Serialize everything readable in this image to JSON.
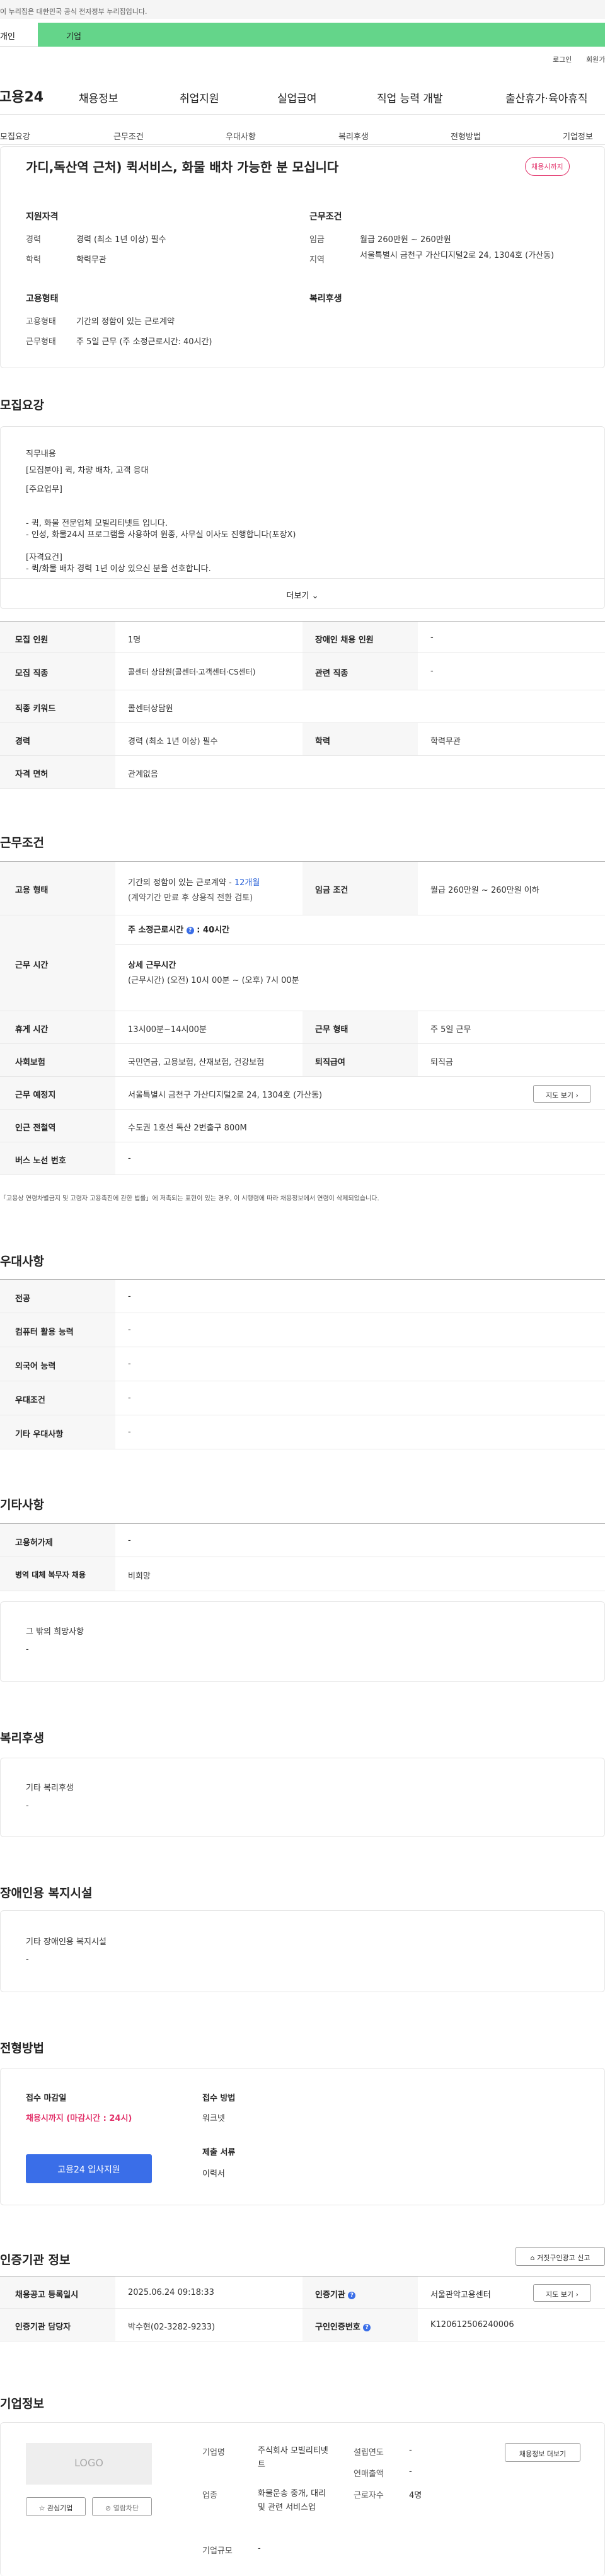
{
  "notice": {
    "text": "이 누리집은 대한민국 공식 전자정부 누리집입니다."
  },
  "top_tabs": [
    "개인",
    "기업"
  ],
  "utility": {
    "login": "로그인",
    "join": "회원가입"
  },
  "gnb": {
    "logo": "고용24",
    "menu": [
      "채용정보",
      "취업지원",
      "실업급여",
      "직업 능력 개발",
      "출산휴가·육아휴직"
    ]
  },
  "anchor_tabs": [
    "모집요강",
    "근무조건",
    "우대사항",
    "복리후생",
    "전형방법",
    "기업정보"
  ],
  "summary": {
    "title": "가디,독산역 근처) 퀵서비스, 화물 배차 가능한 분 모십니다",
    "status_badge": "채용시까지",
    "qualification": {
      "heading": "지원자격",
      "career_label": "경력",
      "career_value": "경력 (최소 1년 이상) 필수",
      "edu_label": "학력",
      "edu_value": "학력무관"
    },
    "conditions": {
      "heading": "근무조건",
      "wage_label": "임금",
      "wage_value": "월급 260만원 ~ 260만원",
      "region_label": "지역",
      "region_value": "서울특별시 금천구 가산디지털2로 24, 1304호 (가산동)"
    },
    "employment": {
      "heading": "고용형태",
      "type_label": "고용형태",
      "type_value": "기간의 정함이 있는 근로계약",
      "work_label": "근무형태",
      "work_value": "주 5일 근무 (주 소정근로시간: 40시간)"
    },
    "welfare": {
      "heading": "복리후생"
    }
  },
  "recruit": {
    "heading": "모집요강",
    "job_desc_label": "직무내용",
    "job_desc_lines": [
      "[모집분야] 퀵, 차량 배차, 고객 응대",
      "[주요업무]",
      "- 퀵, 화물 전문업체 모빌리티넷트 입니다.",
      "- 인성, 화물24시 프로그램을 사용하여 원종, 사무실 이사도 진행합니다(포장X)",
      "[자격요건]",
      "- 퀵/화물 배차 경력 1년 이상 있으신 분을 선호합니다."
    ],
    "more": "더보기",
    "table": {
      "count_label": "모집 인원",
      "count_value": "1명",
      "disabled_label": "장애인 채용 인원",
      "disabled_value": "-",
      "job_label": "모집 직종",
      "job_value": "콜센터 상담원(콜센터·고객센터·CS센터)",
      "related_label": "관련 직종",
      "related_value": "-",
      "keyword_label": "직종 키워드",
      "keyword_value": "콜센터상담원",
      "career_label": "경력",
      "career_value": "경력 (최소 1년 이상) 필수",
      "edu_label": "학력",
      "edu_value": "학력무관",
      "license_label": "자격 면허",
      "license_value": "관계없음"
    }
  },
  "work": {
    "heading": "근무조건",
    "emp_type_label": "고용 형태",
    "emp_type_value": "기간의 정함이 있는 근로계약 - ",
    "emp_period": "12개월",
    "emp_note": "(계약기간 만료 후 상용직 전환 검토)",
    "wage_label": "임금 조건",
    "wage_value": "월급 260만원 ~ 260만원 이하",
    "hours_label": "근무 시간",
    "weekly_label": "주 소정근로시간",
    "weekly_value": "40시간",
    "detail_label": "상세 근무시간",
    "detail_value": "(근무시간) (오전) 10시 00분 ~ (오후) 7시 00분",
    "break_label": "휴게 시간",
    "break_value": "13시00분~14시00분",
    "shift_label": "근무 형태",
    "shift_value": "주 5일 근무",
    "insurance_label": "사회보험",
    "insurance_value": "국민연금, 고용보험, 산재보험, 건강보험",
    "retire_label": "퇴직급여",
    "retire_value": "퇴직금",
    "place_label": "근무 예정지",
    "place_value": "서울특별시 금천구 가산디지털2로 24, 1304호 (가산동)",
    "map_button": "지도 보기",
    "station_label": "인근 전철역",
    "station_value": "수도권 1호선 독산 2번출구 800M",
    "bus_label": "버스 노선 번호",
    "bus_value": "-",
    "footnote": "「고용상 연령차별금지 및 고령자 고용촉진에 관한 법률」에 저촉되는 표현이 있는 경우, 이 시행령에 따라 채용정보에서 연령이 삭제되었습니다."
  },
  "preference": {
    "heading": "우대사항",
    "rows": [
      {
        "label": "전공",
        "value": "-"
      },
      {
        "label": "컴퓨터 활용 능력",
        "value": "-"
      },
      {
        "label": "외국어 능력",
        "value": "-"
      },
      {
        "label": "우대조건",
        "value": "-"
      },
      {
        "label": "기타 우대사항",
        "value": "-"
      }
    ]
  },
  "etc": {
    "heading": "기타사항",
    "rows": [
      {
        "label": "고용허가제",
        "value": "-"
      },
      {
        "label": "병역 대체 복무자 채용",
        "value": "비희망"
      }
    ],
    "other_label": "그 밖의 희망사항",
    "other_value": "-"
  },
  "benefits": {
    "heading": "복리후생",
    "label": "기타 복리후생",
    "value": "-"
  },
  "disability": {
    "heading": "장애인용 복지시설",
    "label": "기타 장애인용 복지시설",
    "value": "-"
  },
  "process": {
    "heading": "전형방법",
    "deadline_label": "접수 마감일",
    "deadline_value": "채용시까지 (마감시간 : 24시)",
    "apply_button": "고용24 입사지원",
    "method_label": "접수 방법",
    "method_value": "워크넷",
    "docs_label": "제출 서류",
    "docs_value": "이력서"
  },
  "agency": {
    "heading": "인증기관 정보",
    "report_button": "거짓구인광고 신고",
    "reg_label": "채용공고 등록일시",
    "reg_value": "2025.06.24 09:18:33",
    "agency_label": "인증기관",
    "agency_value": "서울관악고용센터",
    "map_button": "지도 보기",
    "manager_label": "인증기관 담당자",
    "manager_value": "박수현(02-3282-9233)",
    "id_label": "구인인증번호",
    "id_value": "K120612506240006"
  },
  "company": {
    "heading": "기업정보",
    "logo_text": "LOGO",
    "interest_button": "관심기업",
    "block_button": "열람차단",
    "name_label": "기업명",
    "name_value": "주식회사 모빌리티넷트",
    "industry_label": "업종",
    "industry_value": "화물운송 중개, 대리 및 관련 서비스업",
    "size_label": "기업규모",
    "size_value": "-",
    "founded_label": "설립연도",
    "founded_value": "-",
    "sales_label": "연매출액",
    "sales_value": "-",
    "employees_label": "근로자수",
    "employees_value": "4명",
    "other_jobs_button": "채용정보 더보기"
  }
}
